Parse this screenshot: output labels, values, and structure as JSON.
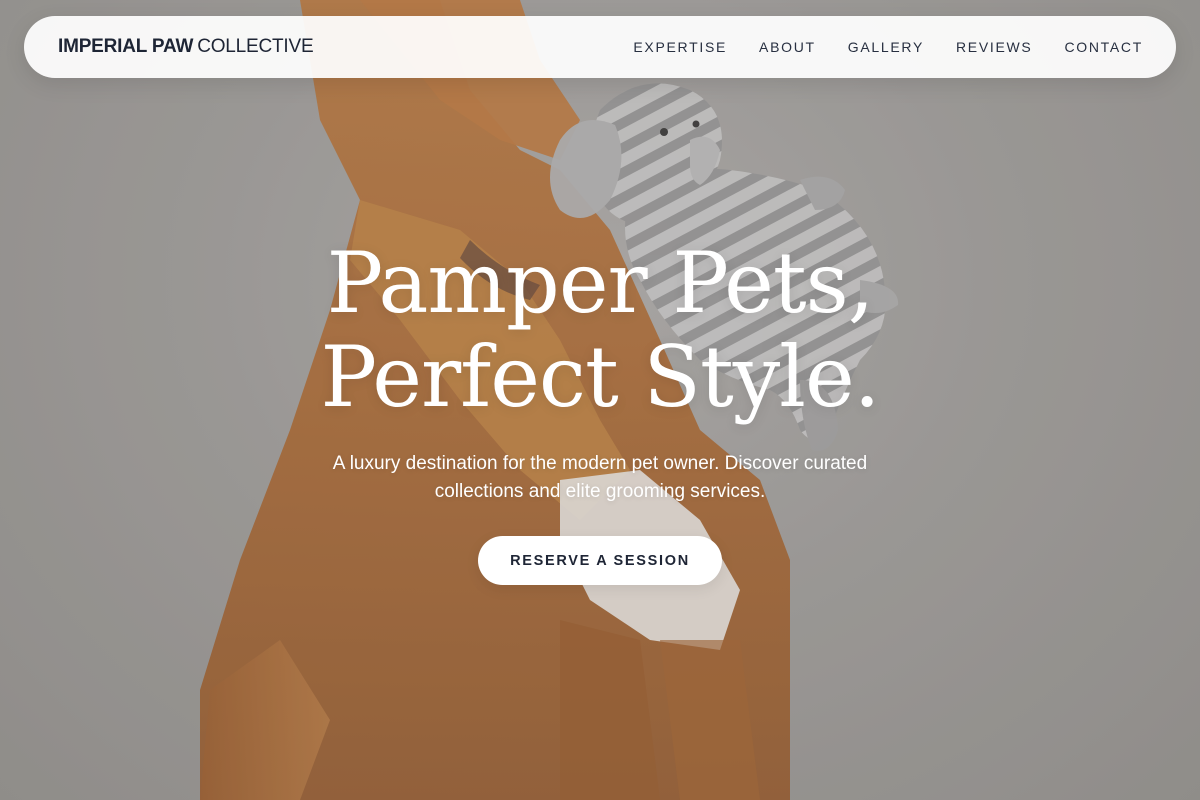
{
  "brand": {
    "name_bold": "IMPERIAL PAW",
    "name_light": "COLLECTIVE"
  },
  "nav": {
    "items": [
      {
        "label": "EXPERTISE"
      },
      {
        "label": "ABOUT"
      },
      {
        "label": "GALLERY"
      },
      {
        "label": "REVIEWS"
      },
      {
        "label": "CONTACT"
      }
    ]
  },
  "hero": {
    "title_line1": "Pamper Pets,",
    "title_line2": "Perfect Style.",
    "subtitle": "A luxury destination for the modern pet owner. Discover curated collections and elite grooming services.",
    "cta_label": "RESERVE A SESSION",
    "background_description_icon": "dog-with-plush-elephant-photo"
  },
  "colors": {
    "brand_text": "#1e2535",
    "nav_background": "#ffffff",
    "hero_text": "#ffffff",
    "background_gray": "#a4a29f",
    "dog_fur": "#b8733a"
  }
}
